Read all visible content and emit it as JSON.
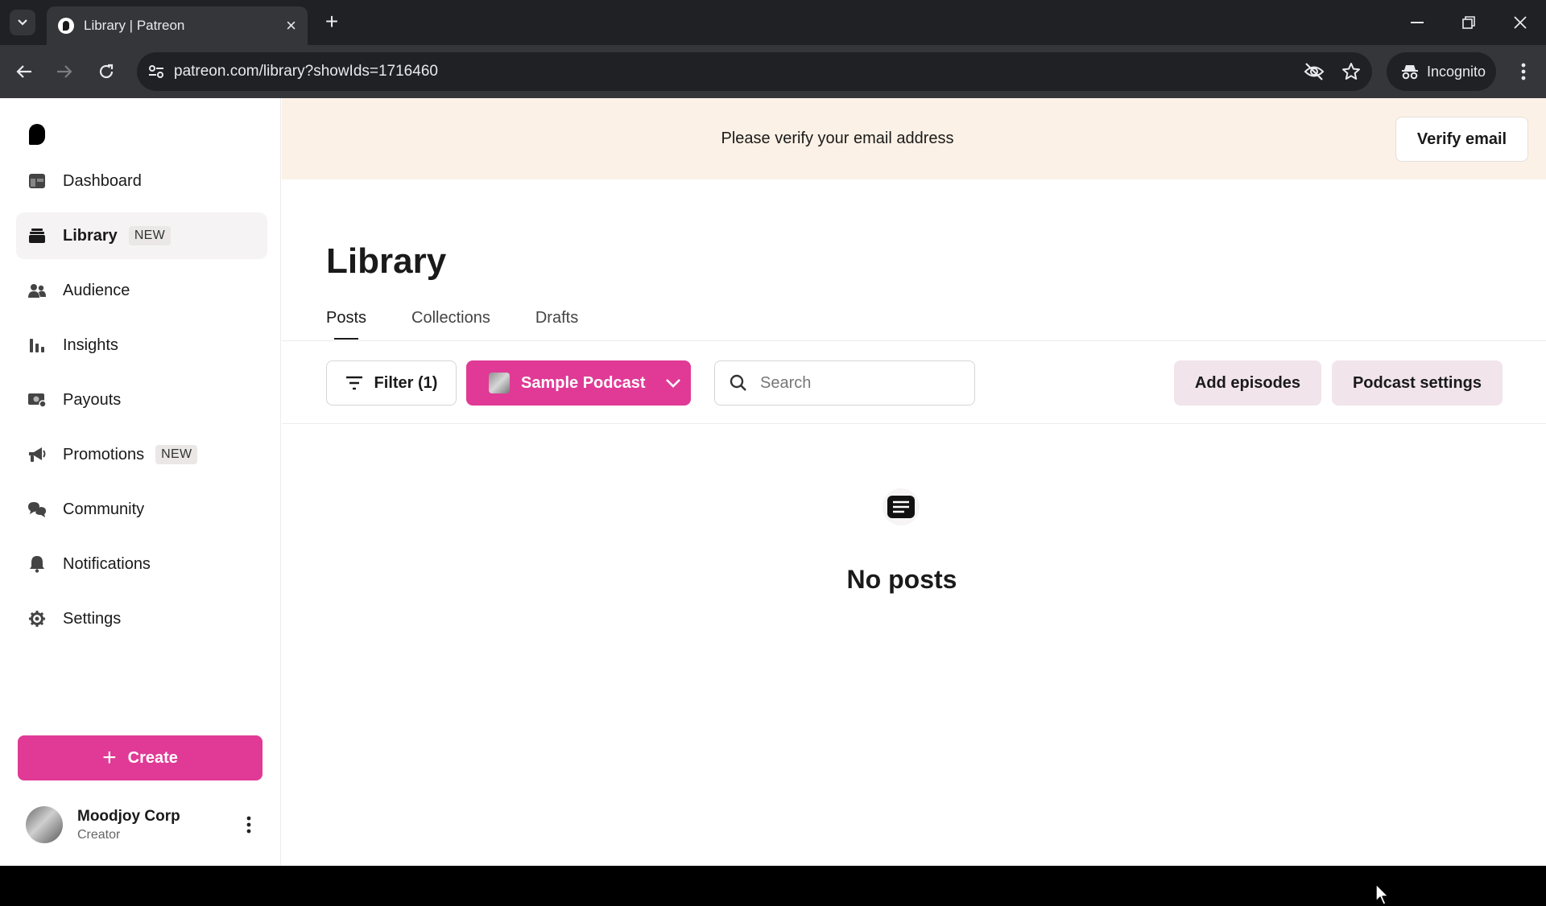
{
  "browser": {
    "tab_title": "Library | Patreon",
    "url": "patreon.com/library?showIds=1716460",
    "incognito_label": "Incognito"
  },
  "sidebar": {
    "items": [
      {
        "label": "Dashboard",
        "badge": "",
        "icon": "dashboard-icon"
      },
      {
        "label": "Library",
        "badge": "NEW",
        "icon": "library-icon",
        "active": true
      },
      {
        "label": "Audience",
        "badge": "",
        "icon": "audience-icon"
      },
      {
        "label": "Insights",
        "badge": "",
        "icon": "insights-icon"
      },
      {
        "label": "Payouts",
        "badge": "",
        "icon": "payouts-icon"
      },
      {
        "label": "Promotions",
        "badge": "NEW",
        "icon": "megaphone-icon"
      },
      {
        "label": "Community",
        "badge": "",
        "icon": "chat-icon"
      },
      {
        "label": "Notifications",
        "badge": "",
        "icon": "bell-icon"
      },
      {
        "label": "Settings",
        "badge": "",
        "icon": "gear-icon"
      }
    ],
    "create_label": "Create",
    "user": {
      "name": "Moodjoy Corp",
      "role": "Creator"
    }
  },
  "banner": {
    "text": "Please verify your email address",
    "button_label": "Verify email"
  },
  "main": {
    "title": "Library",
    "tabs": [
      "Posts",
      "Collections",
      "Drafts"
    ],
    "active_tab": "Posts",
    "filter_label": "Filter (1)",
    "podcast_label": "Sample Podcast",
    "search_placeholder": "Search",
    "add_episodes_label": "Add episodes",
    "podcast_settings_label": "Podcast settings",
    "empty_text": "No posts"
  },
  "colors": {
    "accent": "#e03a96",
    "banner_bg": "#fbf1e6",
    "secondary_btn": "#f1e4ea",
    "chrome_dark": "#202124"
  }
}
